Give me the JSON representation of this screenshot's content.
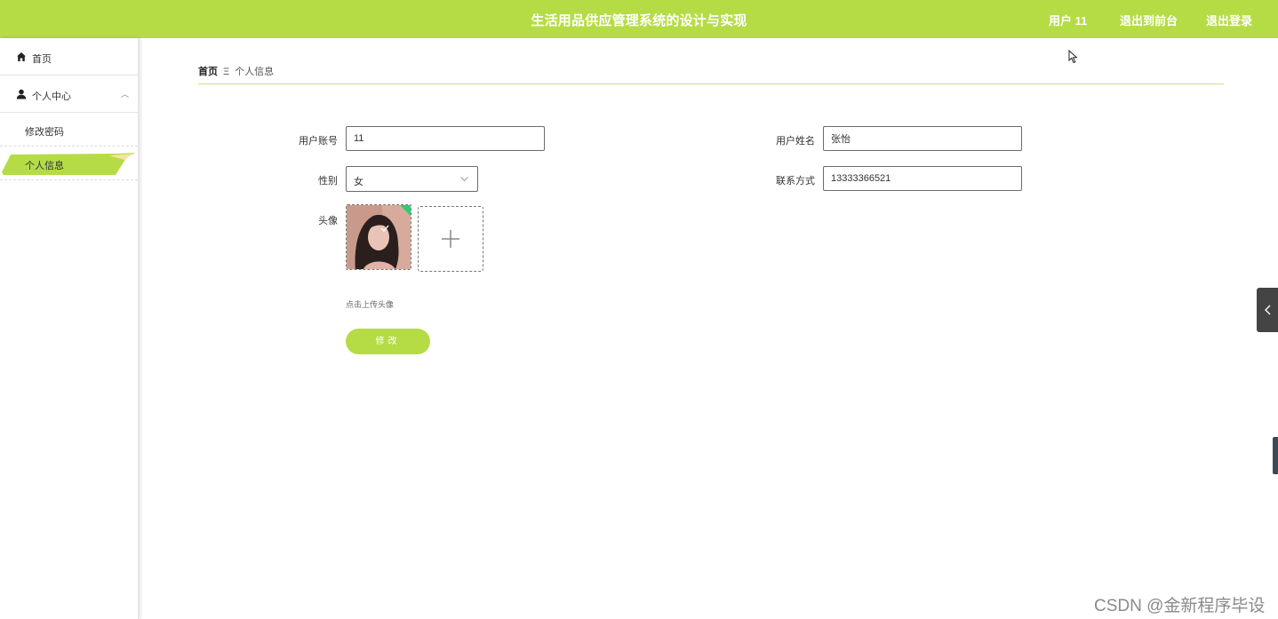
{
  "header": {
    "title": "生活用品供应管理系统的设计与实现",
    "user_label": "用户 11",
    "back_to_front": "退出到前台",
    "logout": "退出登录",
    "brand_color": "#b5dc45"
  },
  "sidebar": {
    "items": [
      {
        "label": "首页",
        "icon": "home-icon"
      },
      {
        "label": "个人中心",
        "icon": "user-icon",
        "expanded": true
      }
    ],
    "sub_items": [
      {
        "label": "修改密码",
        "active": false
      },
      {
        "label": "个人信息",
        "active": true
      }
    ]
  },
  "breadcrumb": {
    "home": "首页",
    "separator": "Ξ",
    "current": "个人信息"
  },
  "form": {
    "account_label": "用户账号",
    "account_value": "11",
    "name_label": "用户姓名",
    "name_value": "张怡",
    "gender_label": "性别",
    "gender_value": "女",
    "contact_label": "联系方式",
    "contact_value": "13333366521",
    "avatar_label": "头像",
    "upload_hint": "点击上传头像",
    "submit_label": "修改"
  },
  "watermark": "CSDN @金新程序毕设"
}
